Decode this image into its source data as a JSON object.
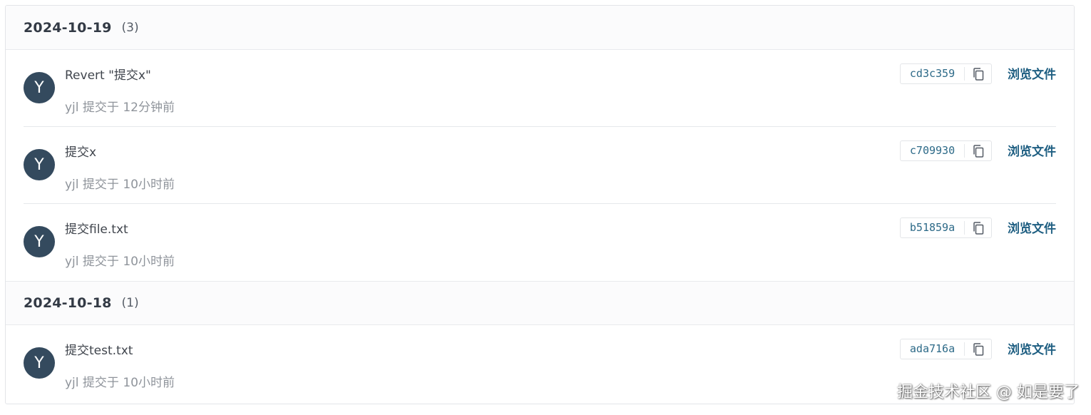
{
  "groups": [
    {
      "date": "2024-10-19",
      "count": "(3)",
      "commits": [
        {
          "avatar": "Y",
          "title": "Revert \"提交x\"",
          "meta": "yjl 提交于 12分钟前",
          "sha": "cd3c359",
          "browse": "浏览文件"
        },
        {
          "avatar": "Y",
          "title": "提交x",
          "meta": "yjl 提交于 10小时前",
          "sha": "c709930",
          "browse": "浏览文件"
        },
        {
          "avatar": "Y",
          "title": "提交file.txt",
          "meta": "yjl 提交于 10小时前",
          "sha": "b51859a",
          "browse": "浏览文件"
        }
      ]
    },
    {
      "date": "2024-10-18",
      "count": "(1)",
      "commits": [
        {
          "avatar": "Y",
          "title": "提交test.txt",
          "meta": "yjl 提交于 10小时前",
          "sha": "ada716a",
          "browse": "浏览文件"
        }
      ]
    }
  ],
  "watermark": "掘金技术社区 @ 如是要了",
  "colors": {
    "avatar_bg": "#344a5e",
    "link": "#1f5f82",
    "sha_text": "#2d6a88",
    "meta_text": "#8f949b"
  },
  "icons": {
    "copy": "copy-icon"
  }
}
